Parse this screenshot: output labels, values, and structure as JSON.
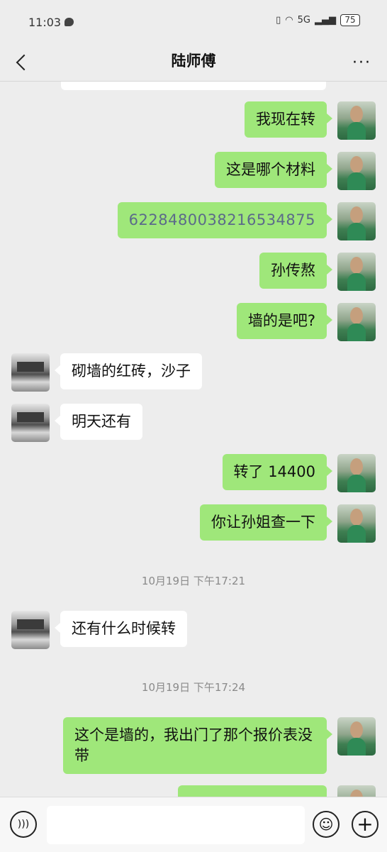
{
  "status_bar": {
    "time": "11:03",
    "network": "5G",
    "battery": "75"
  },
  "header": {
    "title": "陆师傅",
    "more": "···"
  },
  "messages": [
    {
      "side": "right",
      "text": "我现在转"
    },
    {
      "side": "right",
      "text": "这是哪个材料"
    },
    {
      "side": "right",
      "text": "6228480038216534875"
    },
    {
      "side": "right",
      "text": "孙传熬"
    },
    {
      "side": "right",
      "text": "墙的是吧?"
    },
    {
      "side": "left",
      "text": "砌墙的红砖，沙子"
    },
    {
      "side": "left",
      "text": "明天还有"
    },
    {
      "side": "right",
      "text": "转了 14400"
    },
    {
      "side": "right",
      "text": "你让孙姐查一下"
    },
    {
      "side": "left",
      "text": "还有什么时候转"
    },
    {
      "side": "right",
      "text": "这个是墙的，我出门了那个报价表没带"
    }
  ],
  "timestamps": [
    "10月19日 下午17:21",
    "10月19日 下午17:24"
  ],
  "input_bar": {
    "placeholder": ""
  }
}
